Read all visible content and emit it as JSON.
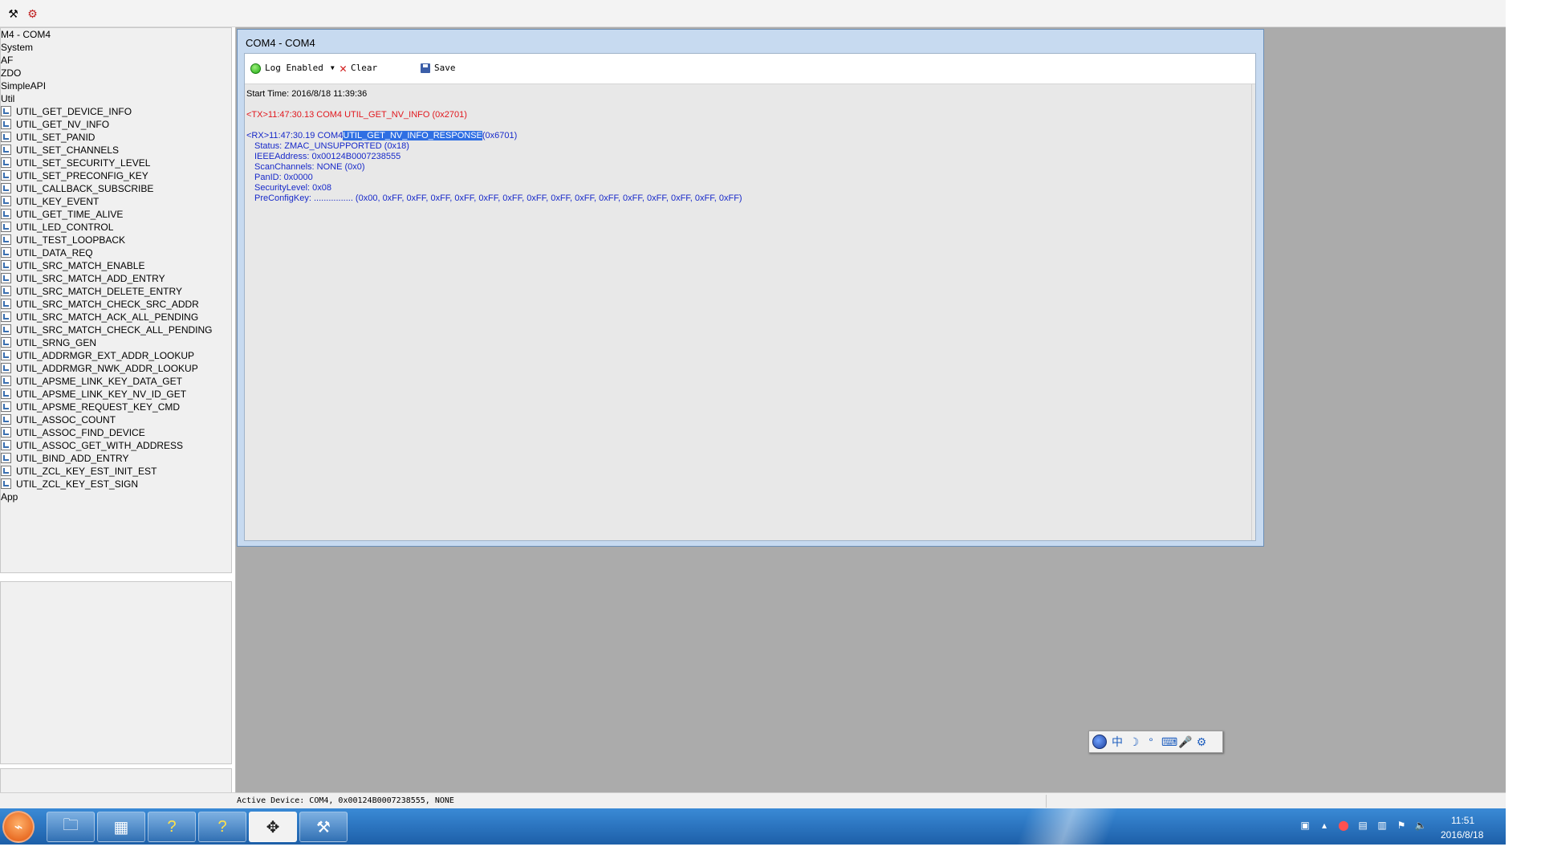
{
  "toolbar": {
    "icons": [
      "tools-icon",
      "search-settings-icon"
    ]
  },
  "tree": {
    "root": "M4 - COM4",
    "groups": [
      "System",
      "AF",
      "ZDO",
      "SimpleAPI",
      "Util"
    ],
    "commands": [
      "UTIL_GET_DEVICE_INFO",
      "UTIL_GET_NV_INFO",
      "UTIL_SET_PANID",
      "UTIL_SET_CHANNELS",
      "UTIL_SET_SECURITY_LEVEL",
      "UTIL_SET_PRECONFIG_KEY",
      "UTIL_CALLBACK_SUBSCRIBE",
      "UTIL_KEY_EVENT",
      "UTIL_GET_TIME_ALIVE",
      "UTIL_LED_CONTROL",
      "UTIL_TEST_LOOPBACK",
      "UTIL_DATA_REQ",
      "UTIL_SRC_MATCH_ENABLE",
      "UTIL_SRC_MATCH_ADD_ENTRY",
      "UTIL_SRC_MATCH_DELETE_ENTRY",
      "UTIL_SRC_MATCH_CHECK_SRC_ADDR",
      "UTIL_SRC_MATCH_ACK_ALL_PENDING",
      "UTIL_SRC_MATCH_CHECK_ALL_PENDING",
      "UTIL_SRNG_GEN",
      "UTIL_ADDRMGR_EXT_ADDR_LOOKUP",
      "UTIL_ADDRMGR_NWK_ADDR_LOOKUP",
      "UTIL_APSME_LINK_KEY_DATA_GET",
      "UTIL_APSME_LINK_KEY_NV_ID_GET",
      "UTIL_APSME_REQUEST_KEY_CMD",
      "UTIL_ASSOC_COUNT",
      "UTIL_ASSOC_FIND_DEVICE",
      "UTIL_ASSOC_GET_WITH_ADDRESS",
      "UTIL_BIND_ADD_ENTRY",
      "UTIL_ZCL_KEY_EST_INIT_EST",
      "UTIL_ZCL_KEY_EST_SIGN"
    ],
    "last_group": "App"
  },
  "com_window": {
    "title": "COM4 - COM4",
    "log_enabled_label": "Log Enabled",
    "clear_label": "Clear",
    "save_label": "Save",
    "log": {
      "start_time": "Start Time: 2016/8/18 11:39:36",
      "tx_line": "<TX>11:47:30.13 COM4 UTIL_GET_NV_INFO (0x2701)",
      "rx_prefix": "<RX>11:47:30.19 COM4",
      "rx_selected": "UTIL_GET_NV_INFO_RESPONSE",
      "rx_suffix": "(0x6701)",
      "fields": [
        "Status: ZMAC_UNSUPPORTED (0x18)",
        "IEEEAddress: 0x00124B0007238555",
        "ScanChannels: NONE (0x0)",
        "PanID: 0x0000",
        "SecurityLevel: 0x08",
        "PreConfigKey: ................ (0x00, 0xFF, 0xFF, 0xFF, 0xFF, 0xFF, 0xFF, 0xFF, 0xFF, 0xFF, 0xFF, 0xFF, 0xFF, 0xFF, 0xFF, 0xFF)"
      ]
    }
  },
  "ime": {
    "chinese_mode": "中",
    "moon": "☽",
    "punct": "°",
    "keyboard": "⌨",
    "mic": "🎤",
    "settings": "⚙"
  },
  "status_bar": {
    "text": "Active Device: COM4, 0x00124B0007238555, NONE"
  },
  "taskbar": {
    "apps": [
      "folder-icon",
      "calculator-icon",
      "help-icon",
      "help-icon-2",
      "ti-app-icon",
      "tools-app-icon"
    ],
    "clock_time": "11:51",
    "clock_date": "2016/8/18"
  },
  "colors": {
    "tx": "#e1181e",
    "rx": "#1729c9",
    "selection": "#2f6fe3",
    "workspace": "#ababab"
  }
}
